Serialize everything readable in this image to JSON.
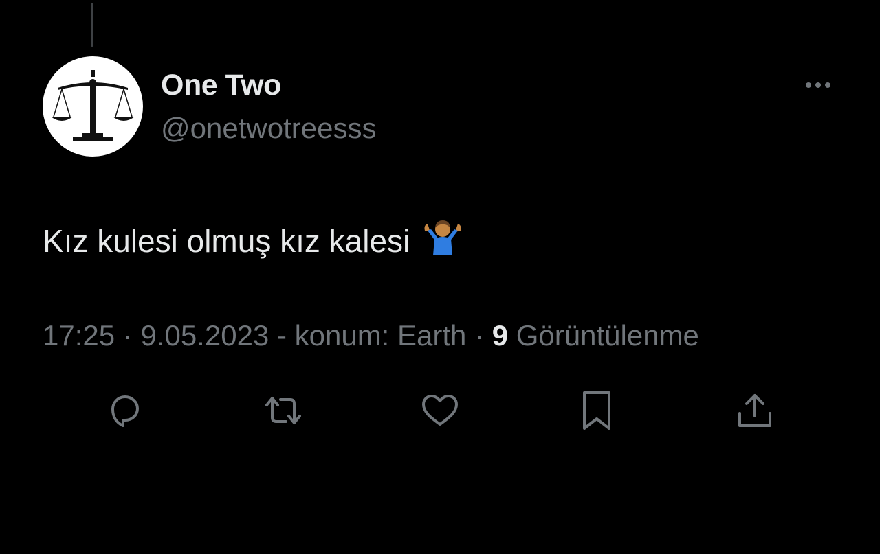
{
  "tweet": {
    "author": {
      "display_name": "One Two",
      "handle": "@onetwotreesss",
      "avatar_icon": "scales-of-justice-icon"
    },
    "text": "Kız kulesi olmuş kız kalesi",
    "emoji": "person-shrugging-emoji",
    "meta": {
      "time": "17:25",
      "sep1": " · ",
      "date": "9.05.2023",
      "location": " - konum: Earth",
      "sep2": " · ",
      "views_count": "9",
      "views_label": " Görüntülenme"
    },
    "actions": [
      {
        "name": "reply",
        "icon": "reply-icon"
      },
      {
        "name": "retweet",
        "icon": "retweet-icon"
      },
      {
        "name": "like",
        "icon": "heart-icon"
      },
      {
        "name": "bookmark",
        "icon": "bookmark-icon"
      },
      {
        "name": "share",
        "icon": "share-icon"
      }
    ]
  },
  "colors": {
    "background": "#000000",
    "primary_text": "#e7e9ea",
    "secondary_text": "#71767b",
    "icon": "#71767b"
  }
}
